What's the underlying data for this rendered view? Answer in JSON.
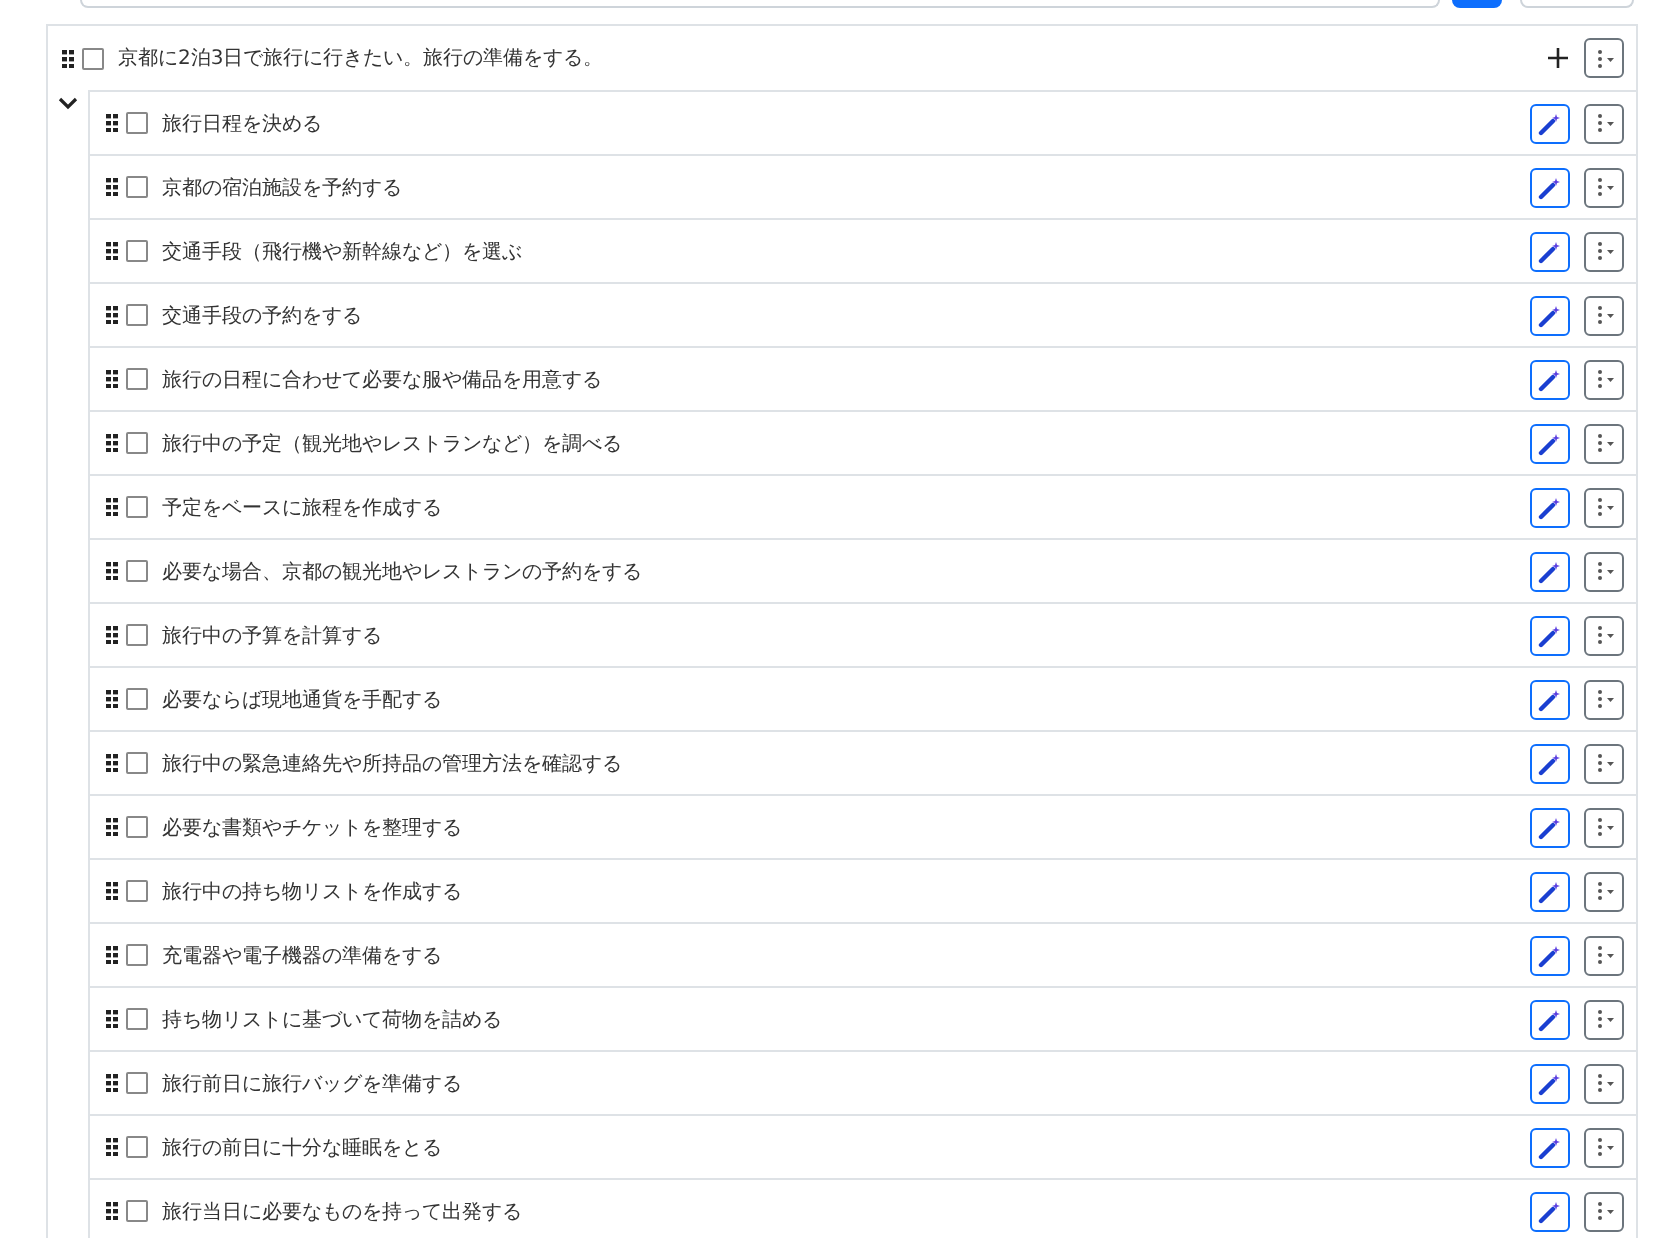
{
  "root_task": {
    "title": "京都に2泊3日で旅行に行きたい。旅行の準備をする。",
    "checked": false,
    "expanded": true
  },
  "subtasks": [
    {
      "title": "旅行日程を決める",
      "checked": false
    },
    {
      "title": "京都の宿泊施設を予約する",
      "checked": false
    },
    {
      "title": "交通手段（飛行機や新幹線など）を選ぶ",
      "checked": false
    },
    {
      "title": "交通手段の予約をする",
      "checked": false
    },
    {
      "title": "旅行の日程に合わせて必要な服や備品を用意する",
      "checked": false
    },
    {
      "title": "旅行中の予定（観光地やレストランなど）を調べる",
      "checked": false
    },
    {
      "title": "予定をベースに旅程を作成する",
      "checked": false
    },
    {
      "title": "必要な場合、京都の観光地やレストランの予約をする",
      "checked": false
    },
    {
      "title": "旅行中の予算を計算する",
      "checked": false
    },
    {
      "title": "必要ならば現地通貨を手配する",
      "checked": false
    },
    {
      "title": "旅行中の緊急連絡先や所持品の管理方法を確認する",
      "checked": false
    },
    {
      "title": "必要な書類やチケットを整理する",
      "checked": false
    },
    {
      "title": "旅行中の持ち物リストを作成する",
      "checked": false
    },
    {
      "title": "充電器や電子機器の準備をする",
      "checked": false
    },
    {
      "title": "持ち物リストに基づいて荷物を詰める",
      "checked": false
    },
    {
      "title": "旅行前日に旅行バッグを準備する",
      "checked": false
    },
    {
      "title": "旅行の前日に十分な睡眠をとる",
      "checked": false
    },
    {
      "title": "旅行当日に必要なものを持って出発する",
      "checked": false
    }
  ]
}
